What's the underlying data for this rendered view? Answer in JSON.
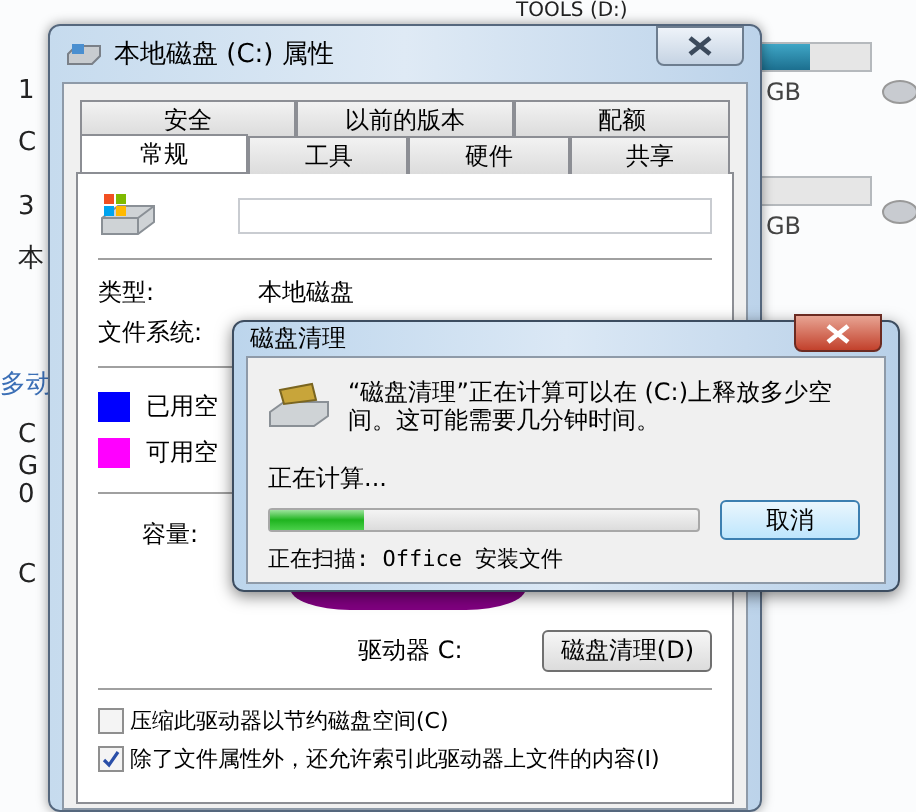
{
  "background_window": {
    "left_fragments": [
      "1",
      "C",
      "3",
      "本",
      "多动",
      "C",
      "G",
      "0",
      "C"
    ],
    "drives": [
      {
        "name": "TOOLS (D:)",
        "level": 0.83,
        "size": "GB"
      },
      {
        "size": "GB"
      }
    ]
  },
  "properties_window": {
    "title": "本地磁盘 (C:) 属性",
    "tab_rows": [
      [
        {
          "label": "安全",
          "selected": false
        },
        {
          "label": "以前的版本",
          "selected": false
        },
        {
          "label": "配额",
          "selected": false
        }
      ],
      [
        {
          "label": "常规",
          "selected": true
        },
        {
          "label": "工具",
          "selected": false
        },
        {
          "label": "硬件",
          "selected": false
        },
        {
          "label": "共享",
          "selected": false
        }
      ]
    ],
    "type_label": "类型:",
    "type_value": "本地磁盘",
    "filesystem_label": "文件系统:",
    "legend": [
      {
        "label": "已用空",
        "color": "#0000ff"
      },
      {
        "label": "可用空",
        "color": "#ff00ff"
      }
    ],
    "capacity_label": "容量:",
    "drive_label": "驱动器 C:",
    "cleanup_button": "磁盘清理(D)",
    "options": [
      {
        "label": "压缩此驱动器以节约磁盘空间(C)",
        "checked": false
      },
      {
        "label": "除了文件属性外，还允许索引此驱动器上文件的内容(I)",
        "checked": true
      }
    ]
  },
  "cleanup_dialog": {
    "title": "磁盘清理",
    "message": "“磁盘清理”正在计算可以在 (C:)上释放多少空间。这可能需要几分钟时间。",
    "status": "正在计算...",
    "level": 0.22,
    "cancel_button": "取消",
    "scanning": "正在扫描:  Office 安装文件"
  }
}
